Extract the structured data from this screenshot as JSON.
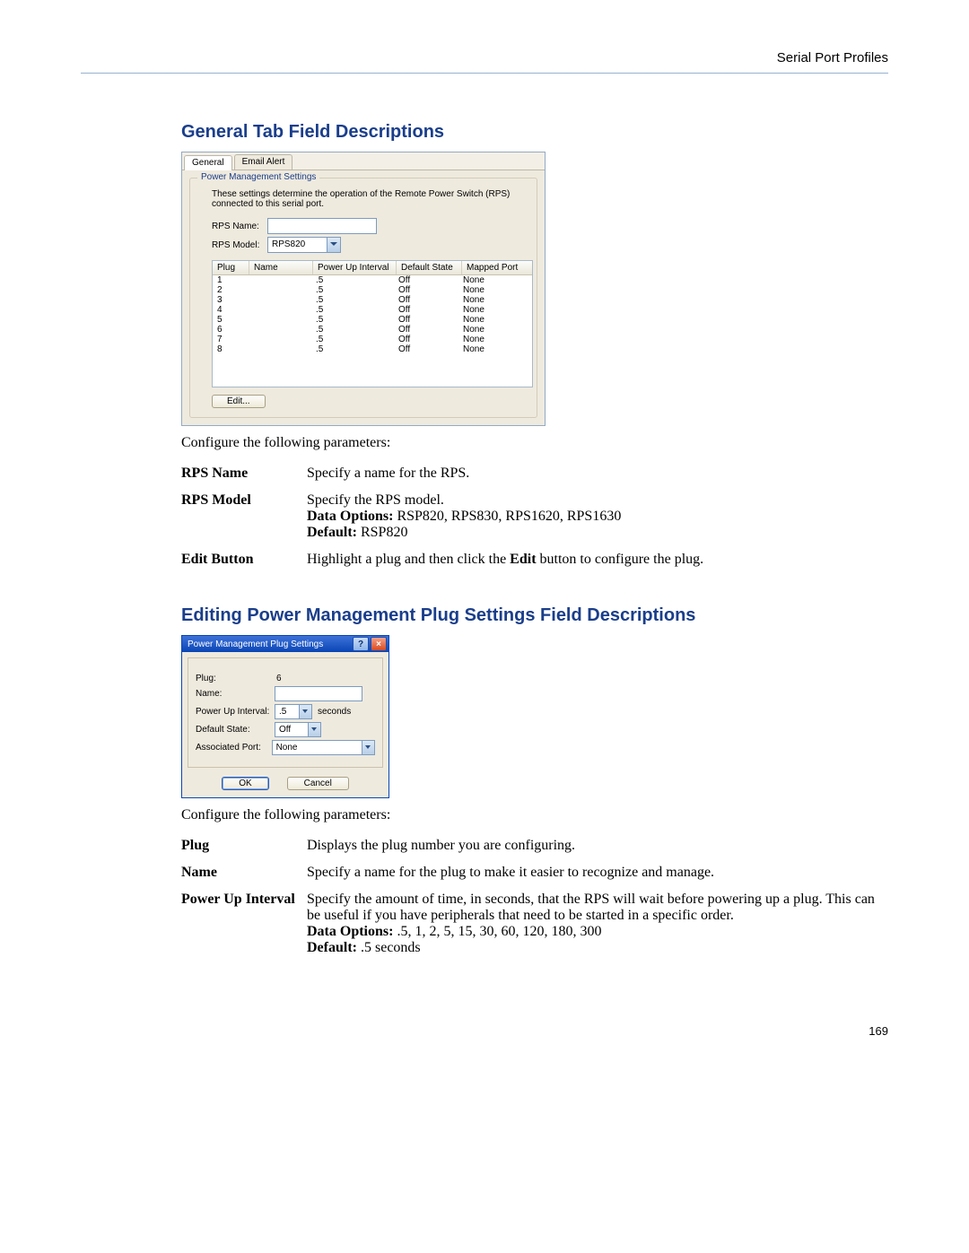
{
  "header": {
    "section_title": "Serial Port Profiles"
  },
  "footer": {
    "page_number": "169"
  },
  "section1": {
    "heading": "General Tab Field Descriptions",
    "configure_text": "Configure the following parameters:",
    "tab_general": "General",
    "tab_email": "Email Alert",
    "fieldset_legend": "Power Management Settings",
    "fieldset_desc": "These settings determine the operation of the Remote Power Switch (RPS) connected to this serial port.",
    "label_rps_name": "RPS Name:",
    "label_rps_model": "RPS Model:",
    "rps_model_value": "RPS820",
    "cols": {
      "plug": "Plug",
      "name": "Name",
      "pui": "Power Up Interval",
      "ds": "Default State",
      "mp": "Mapped Port"
    },
    "rows": [
      {
        "plug": "1",
        "pui": ".5",
        "ds": "Off",
        "mp": "None"
      },
      {
        "plug": "2",
        "pui": ".5",
        "ds": "Off",
        "mp": "None"
      },
      {
        "plug": "3",
        "pui": ".5",
        "ds": "Off",
        "mp": "None"
      },
      {
        "plug": "4",
        "pui": ".5",
        "ds": "Off",
        "mp": "None"
      },
      {
        "plug": "5",
        "pui": ".5",
        "ds": "Off",
        "mp": "None"
      },
      {
        "plug": "6",
        "pui": ".5",
        "ds": "Off",
        "mp": "None"
      },
      {
        "plug": "7",
        "pui": ".5",
        "ds": "Off",
        "mp": "None"
      },
      {
        "plug": "8",
        "pui": ".5",
        "ds": "Off",
        "mp": "None"
      }
    ],
    "edit_btn": "Edit...",
    "defs": {
      "rps_name": {
        "term": "RPS Name",
        "desc": "Specify a name for the RPS."
      },
      "rps_model": {
        "term": "RPS Model",
        "desc": "Specify the RPS model.",
        "opts_label": "Data Options:",
        "opts": " RSP820, RPS830, RPS1620, RPS1630",
        "def_label": "Default:",
        "def": " RSP820"
      },
      "edit_button": {
        "term": "Edit Button",
        "desc_pre": "Highlight a plug and then click the ",
        "desc_bold": "Edit",
        "desc_post": " button to configure the plug."
      }
    }
  },
  "section2": {
    "heading": "Editing Power Management Plug Settings Field Descriptions",
    "configure_text": "Configure the following parameters:",
    "dlg_title": "Power Management Plug Settings",
    "lbl_plug": "Plug:",
    "val_plug": "6",
    "lbl_name": "Name:",
    "lbl_pui": "Power Up Interval:",
    "val_pui": ".5",
    "sec": "seconds",
    "lbl_ds": "Default State:",
    "val_ds": "Off",
    "lbl_ap": "Associated Port:",
    "val_ap": "None",
    "btn_ok": "OK",
    "btn_cancel": "Cancel",
    "defs": {
      "plug": {
        "term": "Plug",
        "desc": "Displays the plug number you are configuring."
      },
      "name": {
        "term": "Name",
        "desc": "Specify a name for the plug to make it easier to recognize and manage."
      },
      "pui": {
        "term": "Power Up Interval",
        "desc": "Specify the amount of time, in seconds, that the RPS will wait before powering up a plug. This can be useful if you have peripherals that need to be started in a specific order.",
        "opts_label": "Data Options:",
        "opts": " .5, 1, 2, 5, 15, 30, 60, 120, 180, 300",
        "def_label": "Default:",
        "def": " .5 seconds"
      }
    }
  }
}
